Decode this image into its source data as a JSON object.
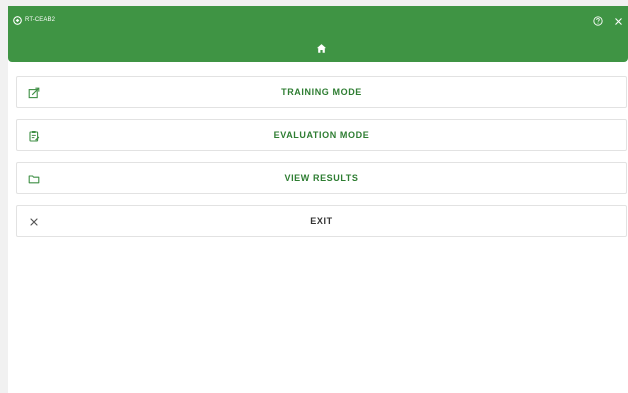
{
  "app": {
    "title": "RT-CEAB2"
  },
  "header": {
    "help_icon": "help-circle-icon",
    "close_icon": "close-icon",
    "home_icon": "home-icon"
  },
  "menu": {
    "items": [
      {
        "label": "TRAINING MODE",
        "icon": "edit-external-icon"
      },
      {
        "label": "EVALUATION MODE",
        "icon": "clipboard-edit-icon"
      },
      {
        "label": "VIEW RESULTS",
        "icon": "folder-icon"
      },
      {
        "label": "EXIT",
        "icon": "close-icon"
      }
    ]
  },
  "colors": {
    "header_bg": "#3f9444",
    "accent_text": "#2e7d32",
    "icon_green": "#3f8f45"
  }
}
